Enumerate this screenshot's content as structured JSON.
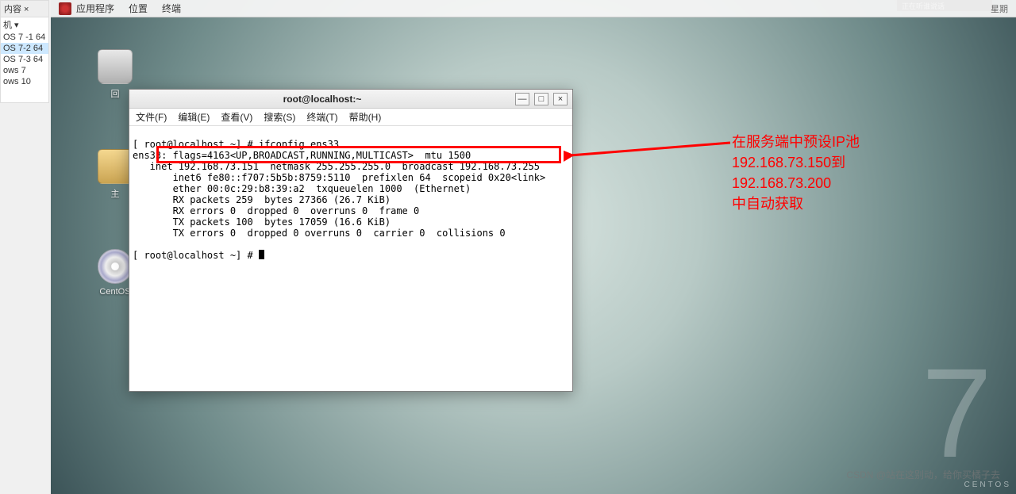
{
  "vm_sidebar": {
    "header": "内容 ×",
    "dropdown": "机",
    "items": [
      "OS 7 -1 64",
      "OS 7-2  64",
      "OS 7-3  64",
      "ows 7",
      "ows 10"
    ],
    "selected_index": 1
  },
  "gnome": {
    "menus": [
      "应用程序",
      "位置",
      "终端"
    ],
    "right_text": "星期",
    "chip": "正在听谁说话"
  },
  "desktop_icons": {
    "trash": "回",
    "home": "主",
    "cd": "CentOS"
  },
  "terminal": {
    "title": "root@localhost:~",
    "menus": [
      "文件(F)",
      "编辑(E)",
      "查看(V)",
      "搜索(S)",
      "终端(T)",
      "帮助(H)"
    ],
    "lines": {
      "l1": "[ root@localhost ~] # ifconfig ens33",
      "l2": "ens33: flags=4163<UP,BROADCAST,RUNNING,MULTICAST>  mtu 1500",
      "hl": "   inet 192.168.73.151  netmask 255.255.255.0  broadcast 192.168.73.255",
      "l3": "       inet6 fe80::f707:5b5b:8759:5110  prefixlen 64  scopeid 0x20<link>",
      "l4": "       ether 00:0c:29:b8:39:a2  txqueuelen 1000  (Ethernet)",
      "l5": "       RX packets 259  bytes 27366 (26.7 KiB)",
      "l6": "       RX errors 0  dropped 0  overruns 0  frame 0",
      "l7": "       TX packets 100  bytes 17059 (16.6 KiB)",
      "l8": "       TX errors 0  dropped 0 overruns 0  carrier 0  collisions 0",
      "l9": "",
      "prompt": "[ root@localhost ~] # "
    },
    "buttons": {
      "min": "—",
      "max": "□",
      "close": "×"
    }
  },
  "annotation": {
    "l1": "在服务端中预设IP池",
    "l2": "192.168.73.150到",
    "l3": "192.168.73.200",
    "l4": "中自动获取"
  },
  "big7": "7",
  "centos_txt": "CENTOS",
  "watermark": "CSDN @站在这别动，给你买橘子去"
}
